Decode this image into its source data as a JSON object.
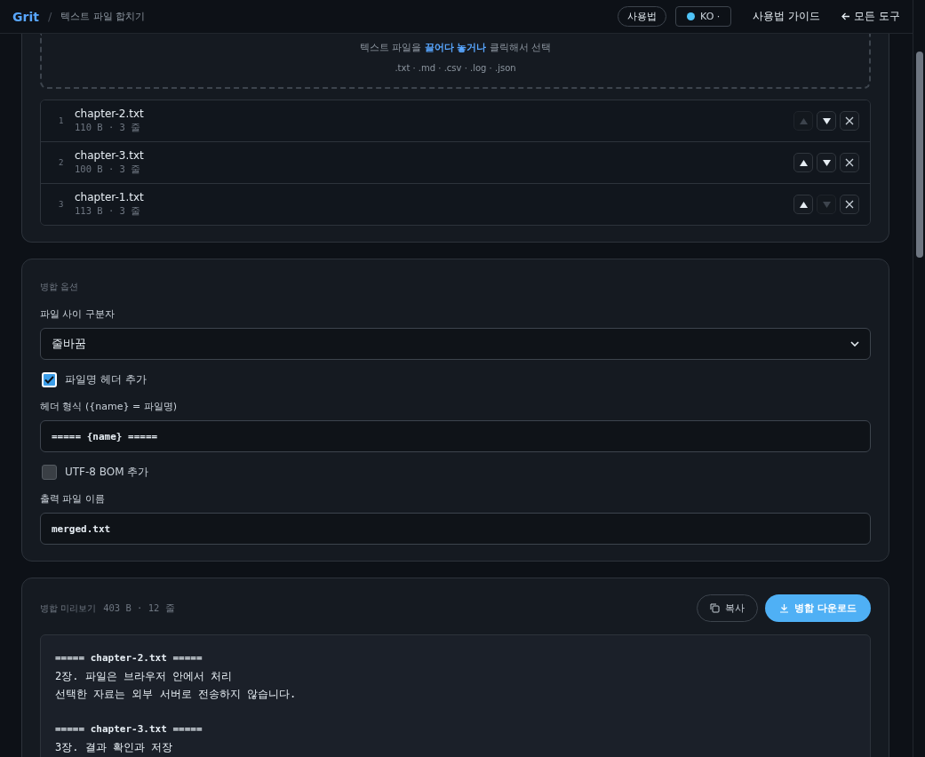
{
  "header": {
    "brand": "Grit",
    "separator": "/",
    "page_title": "텍스트 파일 합치기",
    "usage_button": "사용법",
    "language": {
      "code": "KO",
      "caret": "·"
    },
    "guide_link": "사용법 가이드",
    "all_tools_link": "모든 도구"
  },
  "dropzone": {
    "text_before": "텍스트 파일을",
    "text_emphasis": "끌어다 놓거나",
    "text_after": "클릭해서 선택",
    "formats": ".txt · .md · .csv · .log · .json"
  },
  "files": [
    {
      "index": "1",
      "name": "chapter-2.txt",
      "meta": "110 B · 3 줄",
      "up_disabled": true,
      "down_disabled": false
    },
    {
      "index": "2",
      "name": "chapter-3.txt",
      "meta": "100 B · 3 줄",
      "up_disabled": false,
      "down_disabled": false
    },
    {
      "index": "3",
      "name": "chapter-1.txt",
      "meta": "113 B · 3 줄",
      "up_disabled": false,
      "down_disabled": true
    }
  ],
  "options": {
    "title": "병합 옵션",
    "separator_label": "파일 사이 구분자",
    "separator_value": "줄바꿈",
    "header_checkbox": {
      "label": "파일명 헤더 추가",
      "checked": true
    },
    "header_format_label": "헤더 형식 ({name} = 파일명)",
    "header_format_value": "===== {name} =====",
    "bom_checkbox": {
      "label": "UTF-8 BOM 추가",
      "checked": false
    },
    "output_label": "출력 파일 이름",
    "output_value": "merged.txt"
  },
  "preview": {
    "title": "병합 미리보기",
    "stats": "403 B · 12 줄",
    "copy_button": "복사",
    "download_button": "병합 다운로드",
    "lines": [
      {
        "kind": "header",
        "text": "===== chapter-2.txt ====="
      },
      {
        "kind": "text",
        "text": "2장. 파일은 브라우저 안에서 처리"
      },
      {
        "kind": "text",
        "text": "선택한 자료는 외부 서버로 전송하지 않습니다."
      },
      {
        "kind": "blank"
      },
      {
        "kind": "header",
        "text": "===== chapter-3.txt ====="
      },
      {
        "kind": "text",
        "text": "3장. 결과 확인과 저장"
      }
    ]
  }
}
